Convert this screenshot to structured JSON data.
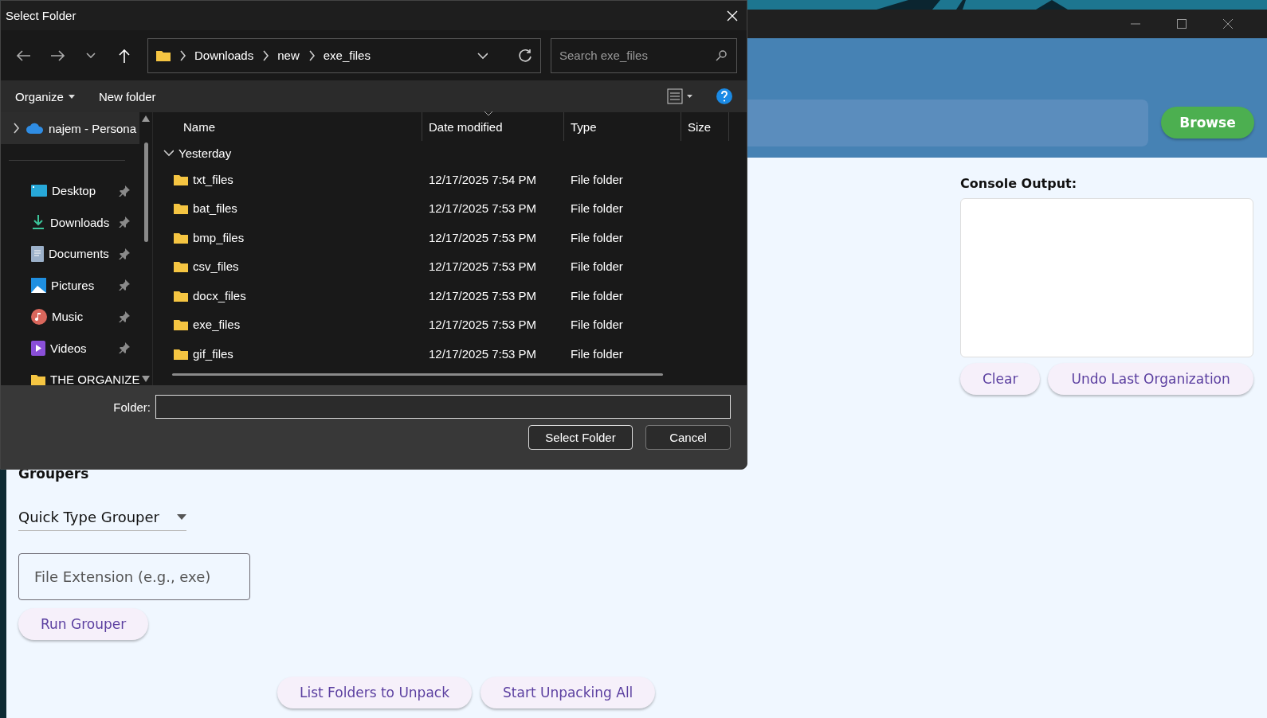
{
  "app": {
    "browse_button": "Browse",
    "console": {
      "label": "Console Output:",
      "buttons": [
        "Clear",
        "Undo Last Organization"
      ]
    },
    "groupers": {
      "heading": "Groupers",
      "dropdown": "Quick Type Grouper",
      "field_placeholder": "File Extension (e.g., exe)",
      "run_button": "Run Grouper"
    },
    "bottom_buttons": [
      "List Folders to Unpack",
      "Start Unpacking All"
    ]
  },
  "dialog": {
    "title": "Select Folder",
    "breadcrumbs": [
      "Downloads",
      "new",
      "exe_files"
    ],
    "search": {
      "placeholder": "Search exe_files"
    },
    "toolbar": {
      "organize": "Organize",
      "new_folder": "New folder"
    },
    "nav_pane": [
      {
        "kind": "cloud",
        "label": "najem - Persona",
        "pinned": false,
        "selected": true
      },
      {
        "kind": "desktop",
        "label": "Desktop",
        "pinned": true,
        "selected": false
      },
      {
        "kind": "download",
        "label": "Downloads",
        "pinned": true,
        "selected": false
      },
      {
        "kind": "documents",
        "label": "Documents",
        "pinned": true,
        "selected": false
      },
      {
        "kind": "pictures",
        "label": "Pictures",
        "pinned": true,
        "selected": false
      },
      {
        "kind": "music",
        "label": "Music",
        "pinned": true,
        "selected": false
      },
      {
        "kind": "videos",
        "label": "Videos",
        "pinned": true,
        "selected": false
      },
      {
        "kind": "folder",
        "label": "THE ORGANIZE",
        "pinned": false,
        "selected": false
      }
    ],
    "columns": [
      {
        "label": "Name",
        "sorted": false
      },
      {
        "label": "Date modified",
        "sorted": true
      },
      {
        "label": "Type",
        "sorted": false
      },
      {
        "label": "Size",
        "sorted": false
      }
    ],
    "group": {
      "label": "Yesterday",
      "expanded": true
    },
    "rows": [
      {
        "name": "txt_files",
        "date": "12/17/2025 7:54 PM",
        "type": "File folder"
      },
      {
        "name": "bat_files",
        "date": "12/17/2025 7:53 PM",
        "type": "File folder"
      },
      {
        "name": "bmp_files",
        "date": "12/17/2025 7:53 PM",
        "type": "File folder"
      },
      {
        "name": "csv_files",
        "date": "12/17/2025 7:53 PM",
        "type": "File folder"
      },
      {
        "name": "docx_files",
        "date": "12/17/2025 7:53 PM",
        "type": "File folder"
      },
      {
        "name": "exe_files",
        "date": "12/17/2025 7:53 PM",
        "type": "File folder"
      },
      {
        "name": "gif_files",
        "date": "12/17/2025 7:53 PM",
        "type": "File folder"
      }
    ],
    "folder_label": "Folder:",
    "buttons": [
      "Select Folder",
      "Cancel"
    ]
  }
}
